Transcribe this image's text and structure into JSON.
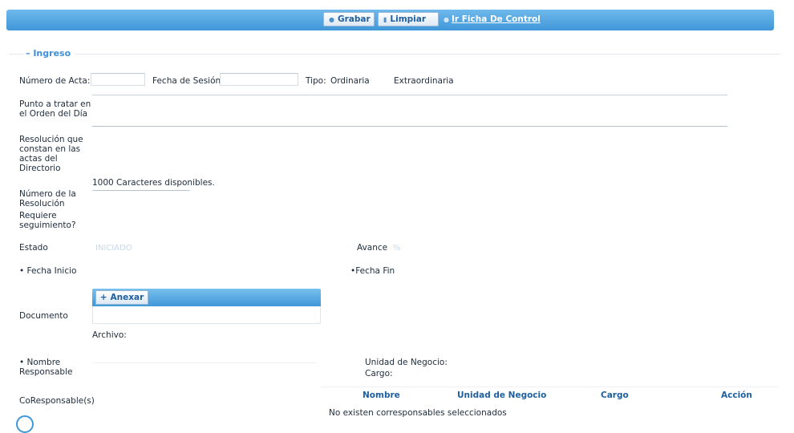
{
  "toolbar": {
    "save_label": "Grabar",
    "clear_label": "Limpiar",
    "control_link": "Ir Ficha De Control"
  },
  "section": {
    "legend": "Ingreso",
    "collapse_glyph": "–"
  },
  "form": {
    "acta_label": "Número de Acta:",
    "fecha_sesion_label": "Fecha de Sesión:",
    "tipo_label": "Tipo:",
    "tipo_options": [
      "Ordinaria",
      "Extraordinaria"
    ],
    "punto_label_1": "Punto a tratar en",
    "punto_label_2": "el Orden del Día",
    "resolucion_label_1": "Resolución que",
    "resolucion_label_2": "constan en las",
    "resolucion_label_3": "actas del",
    "resolucion_label_4": "Directorio",
    "chars_available": "1000 Caracteres disponibles.",
    "num_resolucion_label_1": "Número de la",
    "num_resolucion_label_2": "Resolución",
    "seguimiento_label_1": "Requiere",
    "seguimiento_label_2": "seguimiento?",
    "estado_label": "Estado",
    "estado_value": "INICIADO",
    "avance_label": "Avance",
    "avance_value": "%",
    "fecha_inicio_label": "• Fecha Inicio",
    "fecha_fin_label": "•Fecha Fin",
    "documento_label": "Documento",
    "anexar_label": "Anexar",
    "archivo_label": "Archivo:",
    "responsable_label_1": "• Nombre",
    "responsable_label_2": "Responsable",
    "unidad_label": "Unidad de Negocio:",
    "cargo_label": "Cargo:",
    "coresponsables_label": "CoResponsable(s)"
  },
  "coresp_table": {
    "headers": [
      "Nombre",
      "Unidad de Negocio",
      "Cargo",
      "Acción"
    ],
    "empty_text": "No existen corresponsables seleccionados"
  }
}
